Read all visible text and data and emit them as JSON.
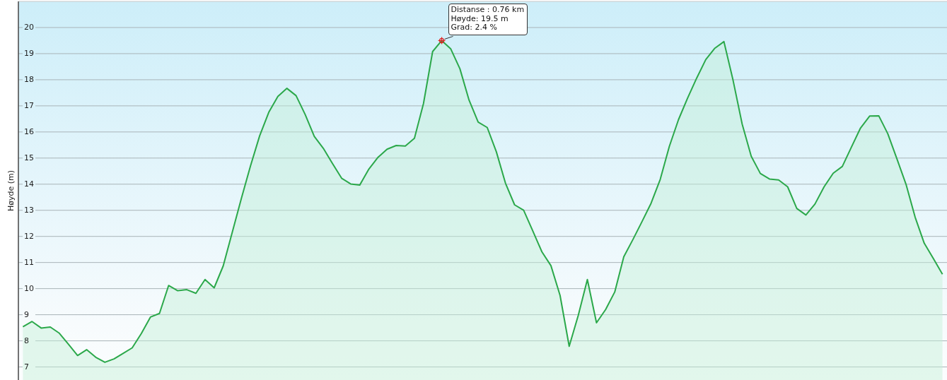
{
  "chart_data": {
    "type": "area",
    "ylabel": "Høyde (m)",
    "ylim": [
      6.5,
      21
    ],
    "yticks": [
      7,
      8,
      9,
      10,
      11,
      12,
      13,
      14,
      15,
      16,
      17,
      18,
      19,
      20
    ],
    "categories": [
      null,
      null,
      null,
      null,
      null,
      null,
      null,
      null,
      null,
      null,
      null,
      null,
      null,
      null,
      null,
      null,
      null,
      null,
      null,
      null,
      null,
      null,
      null,
      null,
      null,
      null,
      null,
      null,
      null,
      null,
      null,
      null,
      null,
      null,
      null,
      null,
      null,
      null,
      null,
      null,
      null,
      null,
      null,
      null,
      null,
      null,
      null,
      null,
      null,
      null,
      null,
      null,
      null,
      null,
      null,
      null,
      null,
      null,
      null,
      null,
      null,
      null,
      null,
      null,
      null,
      null,
      null,
      null,
      null,
      null,
      null,
      null,
      null,
      null,
      null,
      null,
      null,
      null,
      null,
      null,
      null,
      null,
      null,
      null,
      null,
      null,
      null,
      null,
      null,
      null,
      null,
      null,
      null,
      null,
      null,
      null,
      null,
      null,
      null,
      null,
      null,
      null
    ],
    "series": [
      {
        "color": "#2ba84a",
        "values": [
          8.54,
          8.74,
          8.49,
          8.53,
          8.29,
          7.87,
          7.44,
          7.66,
          7.37,
          7.18,
          7.31,
          7.52,
          7.73,
          8.28,
          8.91,
          9.05,
          10.12,
          9.92,
          9.96,
          9.82,
          10.35,
          10.03,
          10.87,
          12.17,
          13.47,
          14.71,
          15.85,
          16.75,
          17.36,
          17.67,
          17.39,
          16.67,
          15.83,
          15.37,
          14.79,
          14.23,
          14.01,
          13.97,
          14.58,
          15.03,
          15.34,
          15.48,
          15.46,
          15.76,
          17.09,
          19.08,
          19.5,
          19.18,
          18.42,
          17.22,
          16.38,
          16.17,
          15.24,
          14.04,
          13.21,
          13.0,
          12.21,
          11.41,
          10.88,
          9.74,
          7.79,
          8.98,
          10.35,
          8.69,
          9.2,
          9.87,
          11.22,
          11.88,
          12.57,
          13.27,
          14.18,
          15.45,
          16.47,
          17.29,
          18.06,
          18.77,
          19.21,
          19.46,
          17.98,
          16.3,
          15.07,
          14.41,
          14.2,
          14.16,
          13.9,
          13.07,
          12.82,
          13.24,
          13.9,
          14.42,
          14.68,
          15.42,
          16.15,
          16.61,
          16.62,
          15.93,
          14.97,
          13.99,
          12.74,
          11.74,
          11.15,
          10.55
        ]
      }
    ],
    "grid": true
  },
  "tooltip": {
    "lines": [
      "Distanse : 0.76 km",
      "Høyde: 19.5 m",
      "Grad: 2.4 %"
    ]
  }
}
